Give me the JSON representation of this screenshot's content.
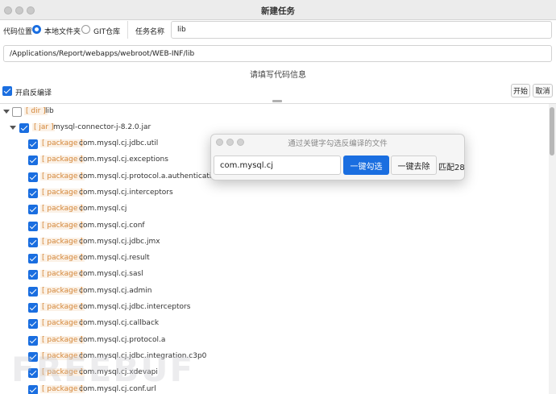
{
  "window": {
    "title": "新建任务"
  },
  "form": {
    "code_location_label": "代码位置",
    "radio_local": "本地文件夹",
    "radio_git": "GIT仓库",
    "task_name_label": "任务名称",
    "task_name_value": "lib",
    "path_value": "/Applications/Report/webapps/webroot/WEB-INF/lib",
    "section_title": "请填写代码信息",
    "decompile_label": "开启反编译",
    "decompile_checked": true,
    "start_button": "开始",
    "cancel_button": "取消"
  },
  "tree": {
    "root": {
      "tag": "[ dir ]",
      "name": "lib",
      "checked": false
    },
    "jar": {
      "tag": "[ jar ]",
      "name": "mysql-connector-j-8.2.0.jar",
      "checked": true
    },
    "package_tag": "[ package ]",
    "packages": [
      "com.mysql.cj.jdbc.util",
      "com.mysql.cj.exceptions",
      "com.mysql.cj.protocol.a.authentication",
      "com.mysql.cj.interceptors",
      "com.mysql.cj",
      "com.mysql.cj.conf",
      "com.mysql.cj.jdbc.jmx",
      "com.mysql.cj.result",
      "com.mysql.cj.sasl",
      "com.mysql.cj.admin",
      "com.mysql.cj.jdbc.interceptors",
      "com.mysql.cj.callback",
      "com.mysql.cj.protocol.a",
      "com.mysql.cj.jdbc.integration.c3p0",
      "com.mysql.cj.xdevapi",
      "com.mysql.cj.conf.url"
    ]
  },
  "dialog": {
    "title": "通过关键字勾选反编译的文件",
    "keyword_value": "com.mysql.cj",
    "select_button": "一键勾选",
    "remove_button": "一键去除",
    "match_text": "匹配28"
  },
  "colors": {
    "accent": "#1a6ee0",
    "tag": "#d4873a"
  }
}
